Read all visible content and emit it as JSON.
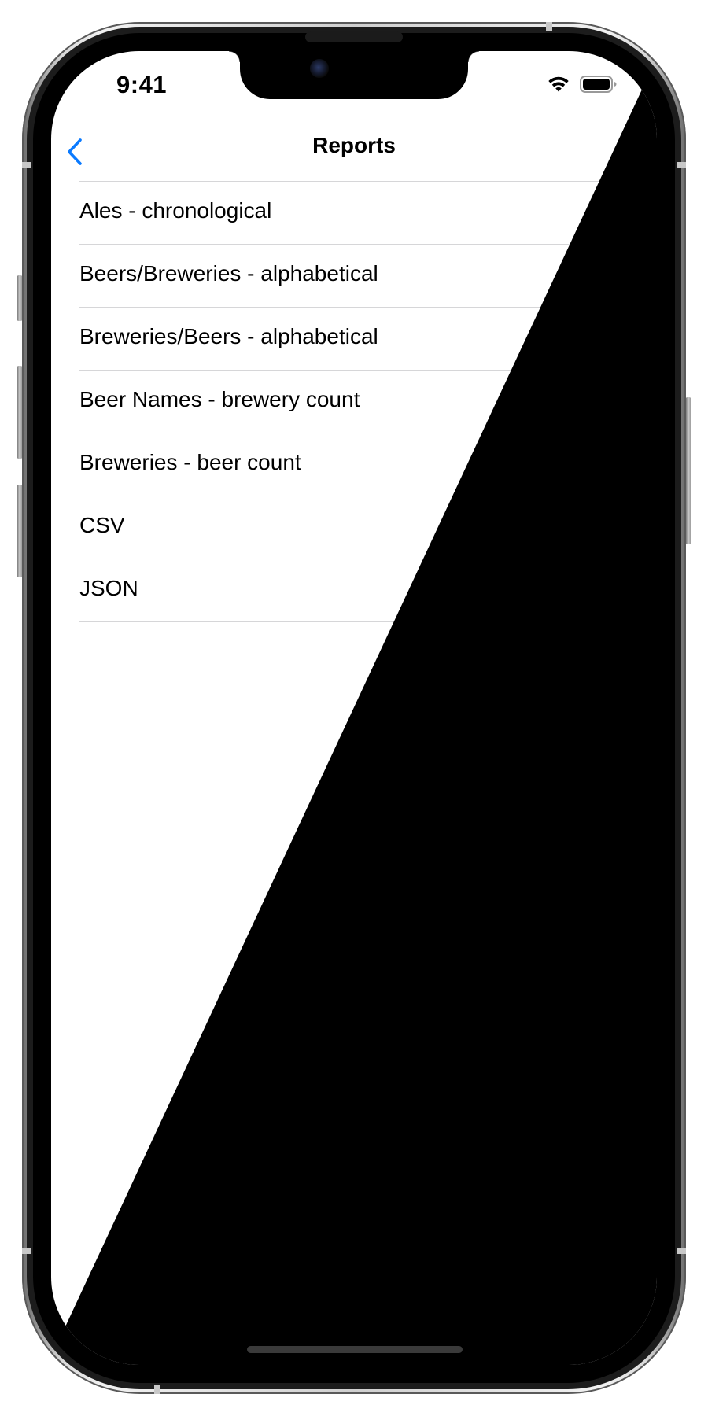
{
  "status_bar": {
    "time": "9:41",
    "icons": [
      "wifi-icon",
      "battery-icon"
    ]
  },
  "nav": {
    "back_icon": "chevron-left-icon",
    "title": "Reports"
  },
  "reports": [
    {
      "label": "Ales - chronological"
    },
    {
      "label": "Beers/Breweries - alphabetical"
    },
    {
      "label": "Breweries/Beers - alphabetical"
    },
    {
      "label": "Beer Names - brewery count"
    },
    {
      "label": "Breweries - beer count"
    },
    {
      "label": "CSV"
    },
    {
      "label": "JSON"
    }
  ],
  "colors": {
    "accent": "#0a7aff",
    "separator": "#d6d6d8",
    "chevron": "#c4c4c7"
  }
}
